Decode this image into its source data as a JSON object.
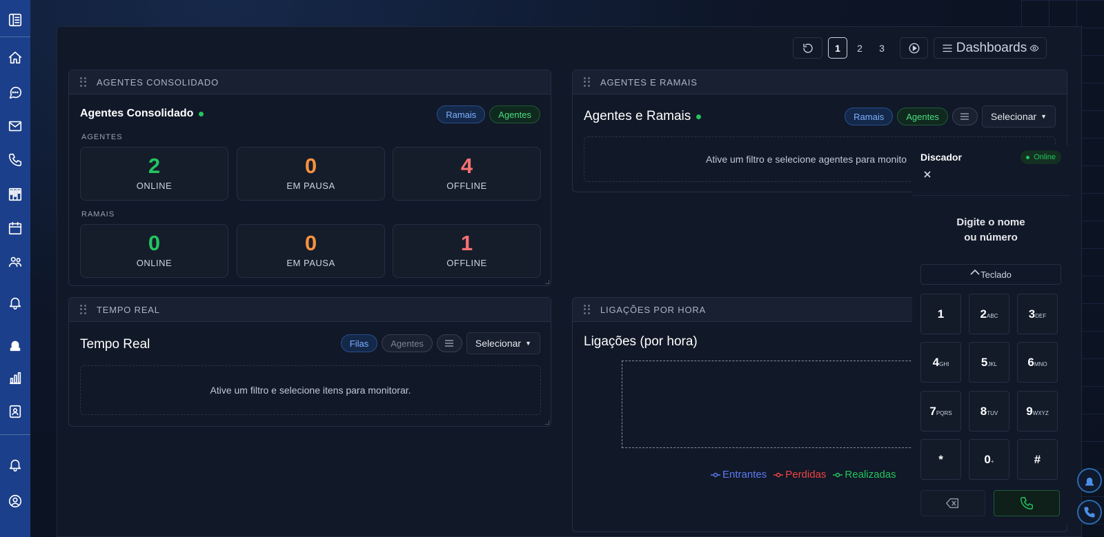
{
  "toolbar": {
    "pages": [
      "1",
      "2",
      "3"
    ],
    "active_page": "1",
    "dashboards_label": "Dashboards"
  },
  "agents_consolidated": {
    "header": "AGENTES CONSOLIDADO",
    "title": "Agentes Consolidado",
    "pill_ramais": "Ramais",
    "pill_agentes": "Agentes",
    "agents_label": "AGENTES",
    "ramais_label": "RAMAIS",
    "agents_stats": [
      {
        "value": "2",
        "label": "ONLINE"
      },
      {
        "value": "0",
        "label": "EM PAUSA"
      },
      {
        "value": "4",
        "label": "OFFLINE"
      }
    ],
    "ramais_stats": [
      {
        "value": "0",
        "label": "ONLINE"
      },
      {
        "value": "0",
        "label": "EM PAUSA"
      },
      {
        "value": "1",
        "label": "OFFLINE"
      }
    ]
  },
  "agents_ramais": {
    "header": "AGENTES E RAMAIS",
    "title": "Agentes e Ramais",
    "pill_ramais": "Ramais",
    "pill_agentes": "Agentes",
    "select_label": "Selecionar",
    "empty_text": "Ative um filtro e selecione agentes para monito"
  },
  "realtime": {
    "header": "TEMPO REAL",
    "title": "Tempo Real",
    "pill_filas": "Filas",
    "pill_agentes": "Agentes",
    "select_label": "Selecionar",
    "empty_text": "Ative um filtro e selecione itens para monitorar."
  },
  "calls_per_hour": {
    "header": "LIGAÇÕES POR HORA",
    "title": "Ligações (por hora)",
    "legend": [
      {
        "name": "Entrantes",
        "color": "#5b7cf0"
      },
      {
        "name": "Perdidas",
        "color": "#ef4444"
      },
      {
        "name": "Realizadas",
        "color": "#22c55e"
      }
    ]
  },
  "dialer": {
    "title": "Discador",
    "status": "Online",
    "prompt_line1": "Digite o nome",
    "prompt_line2": "ou número",
    "keyboard_toggle": "Teclado",
    "keys": [
      {
        "d": "1",
        "s": ""
      },
      {
        "d": "2",
        "s": "ABC"
      },
      {
        "d": "3",
        "s": "DEF"
      },
      {
        "d": "4",
        "s": "GHI"
      },
      {
        "d": "5",
        "s": "JKL"
      },
      {
        "d": "6",
        "s": "MNO"
      },
      {
        "d": "7",
        "s": "PQRS"
      },
      {
        "d": "8",
        "s": "TUV"
      },
      {
        "d": "9",
        "s": "WXYZ"
      },
      {
        "d": "*",
        "s": ""
      },
      {
        "d": "0",
        "s": "+"
      },
      {
        "d": "#",
        "s": ""
      }
    ]
  },
  "colors": {
    "sidebar": "#1b3f8a",
    "online": "#22c55e",
    "pause": "#fb923c",
    "offline": "#f87171"
  }
}
